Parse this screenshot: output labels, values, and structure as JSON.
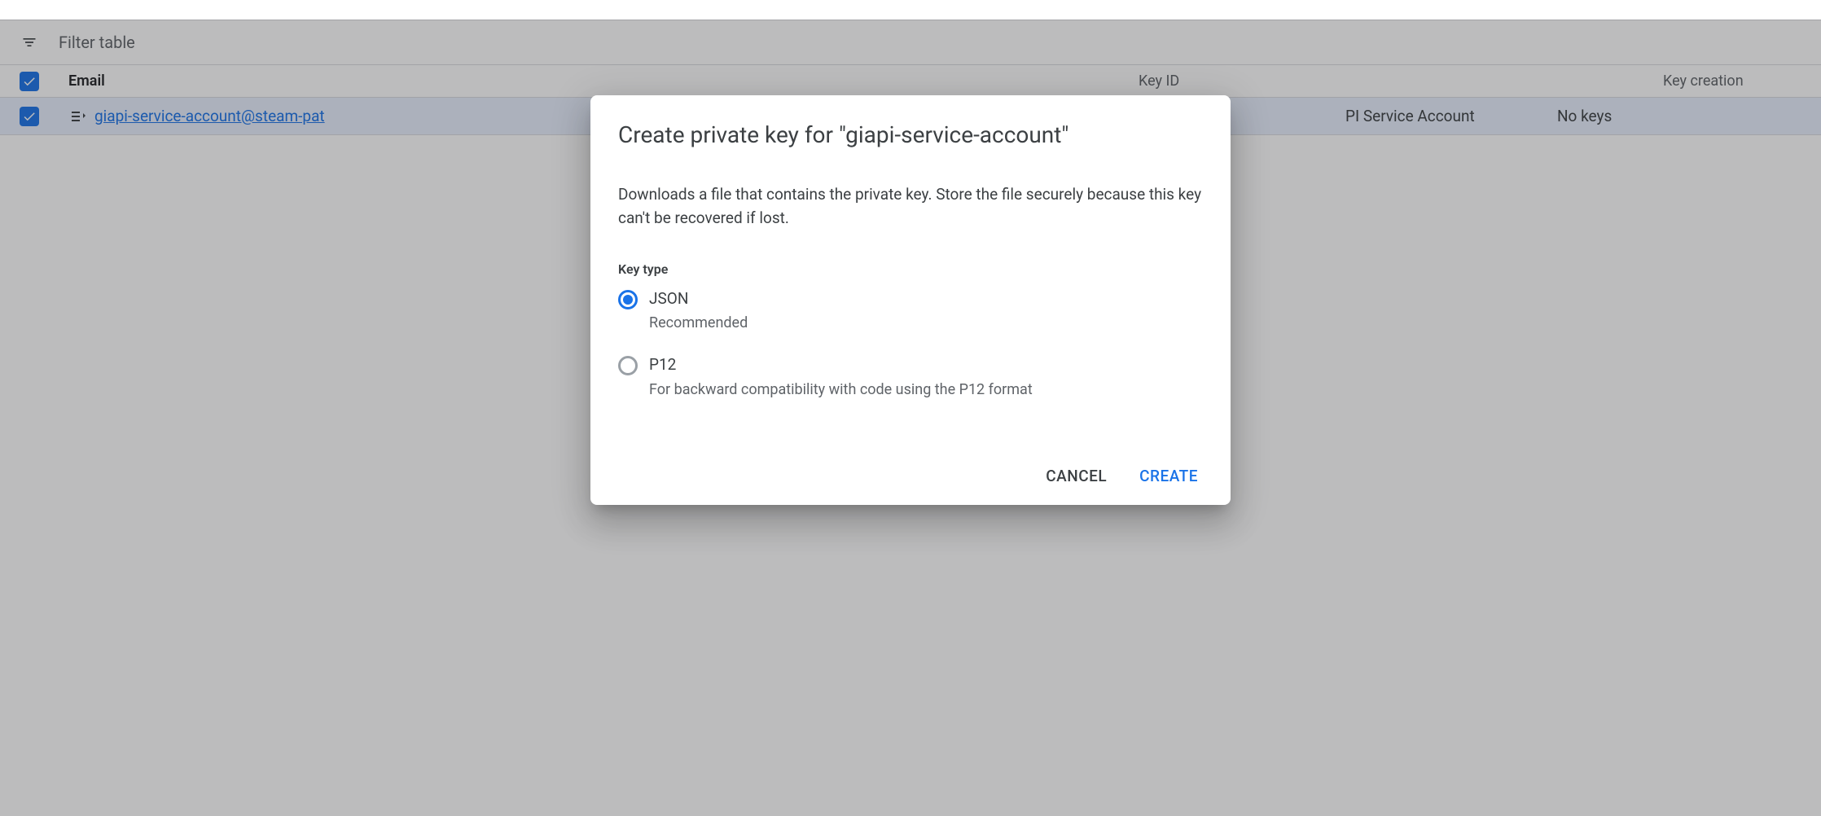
{
  "filter": {
    "placeholder": "Filter table"
  },
  "table": {
    "headers": {
      "email": "Email",
      "keyId": "Key ID",
      "keyCreation": "Key creation"
    },
    "row": {
      "email": "giapi-service-account@steam-pat",
      "name": "PI Service Account",
      "keyId": "No keys"
    }
  },
  "dialog": {
    "title": "Create private key for \"giapi-service-account\"",
    "description": "Downloads a file that contains the private key. Store the file securely because this key can't be recovered if lost.",
    "keyTypeLabel": "Key type",
    "options": {
      "json": {
        "label": "JSON",
        "sublabel": "Recommended"
      },
      "p12": {
        "label": "P12",
        "sublabel": "For backward compatibility with code using the P12 format"
      }
    },
    "actions": {
      "cancel": "CANCEL",
      "create": "CREATE"
    }
  }
}
